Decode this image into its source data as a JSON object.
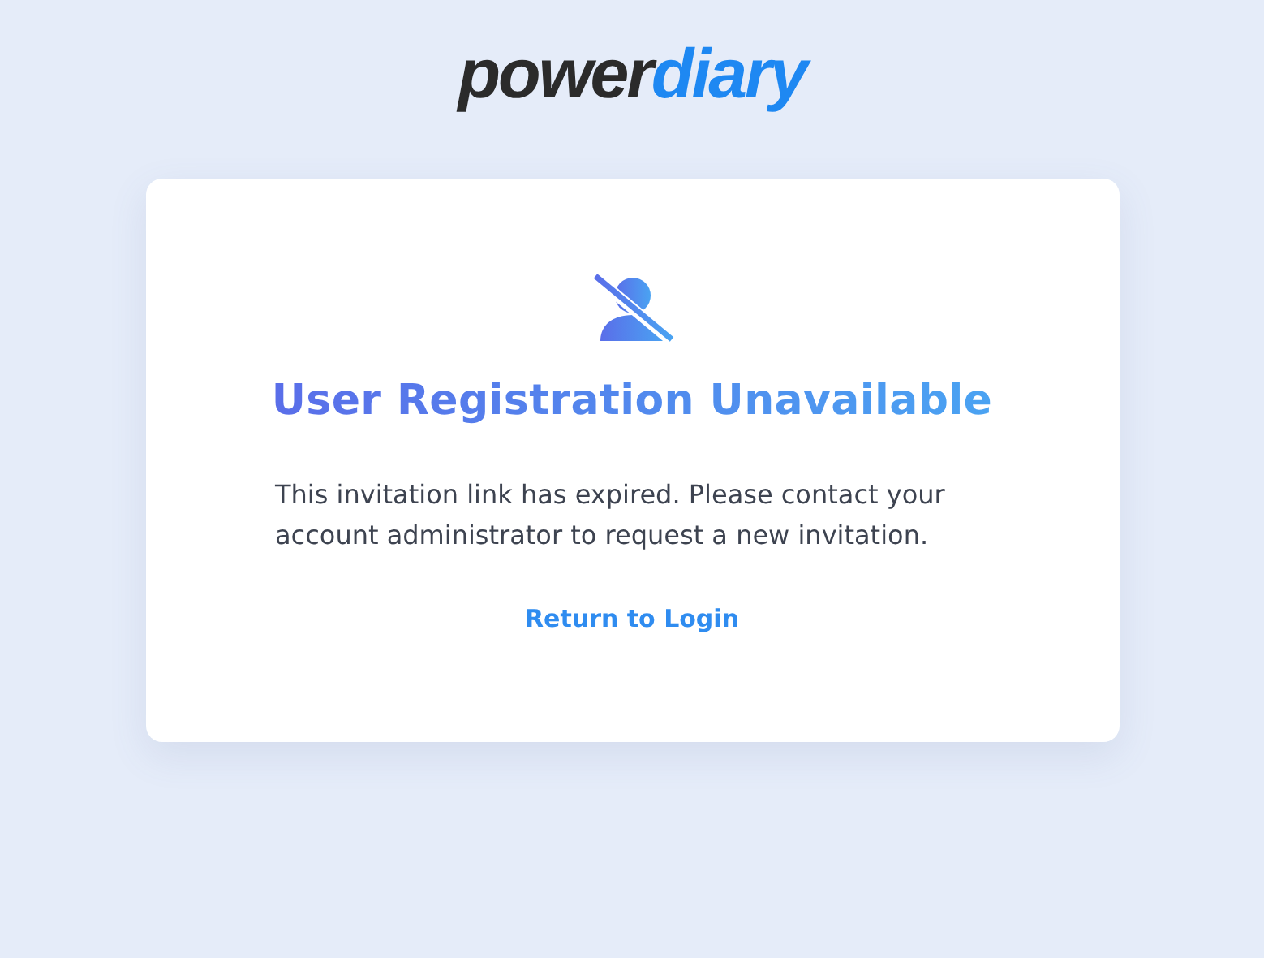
{
  "logo": {
    "first": "power",
    "second": "diary"
  },
  "card": {
    "title": "User Registration Unavailable",
    "message": "This invitation link has expired. Please contact your account administrator to request a new invitation.",
    "link": "Return to Login"
  }
}
